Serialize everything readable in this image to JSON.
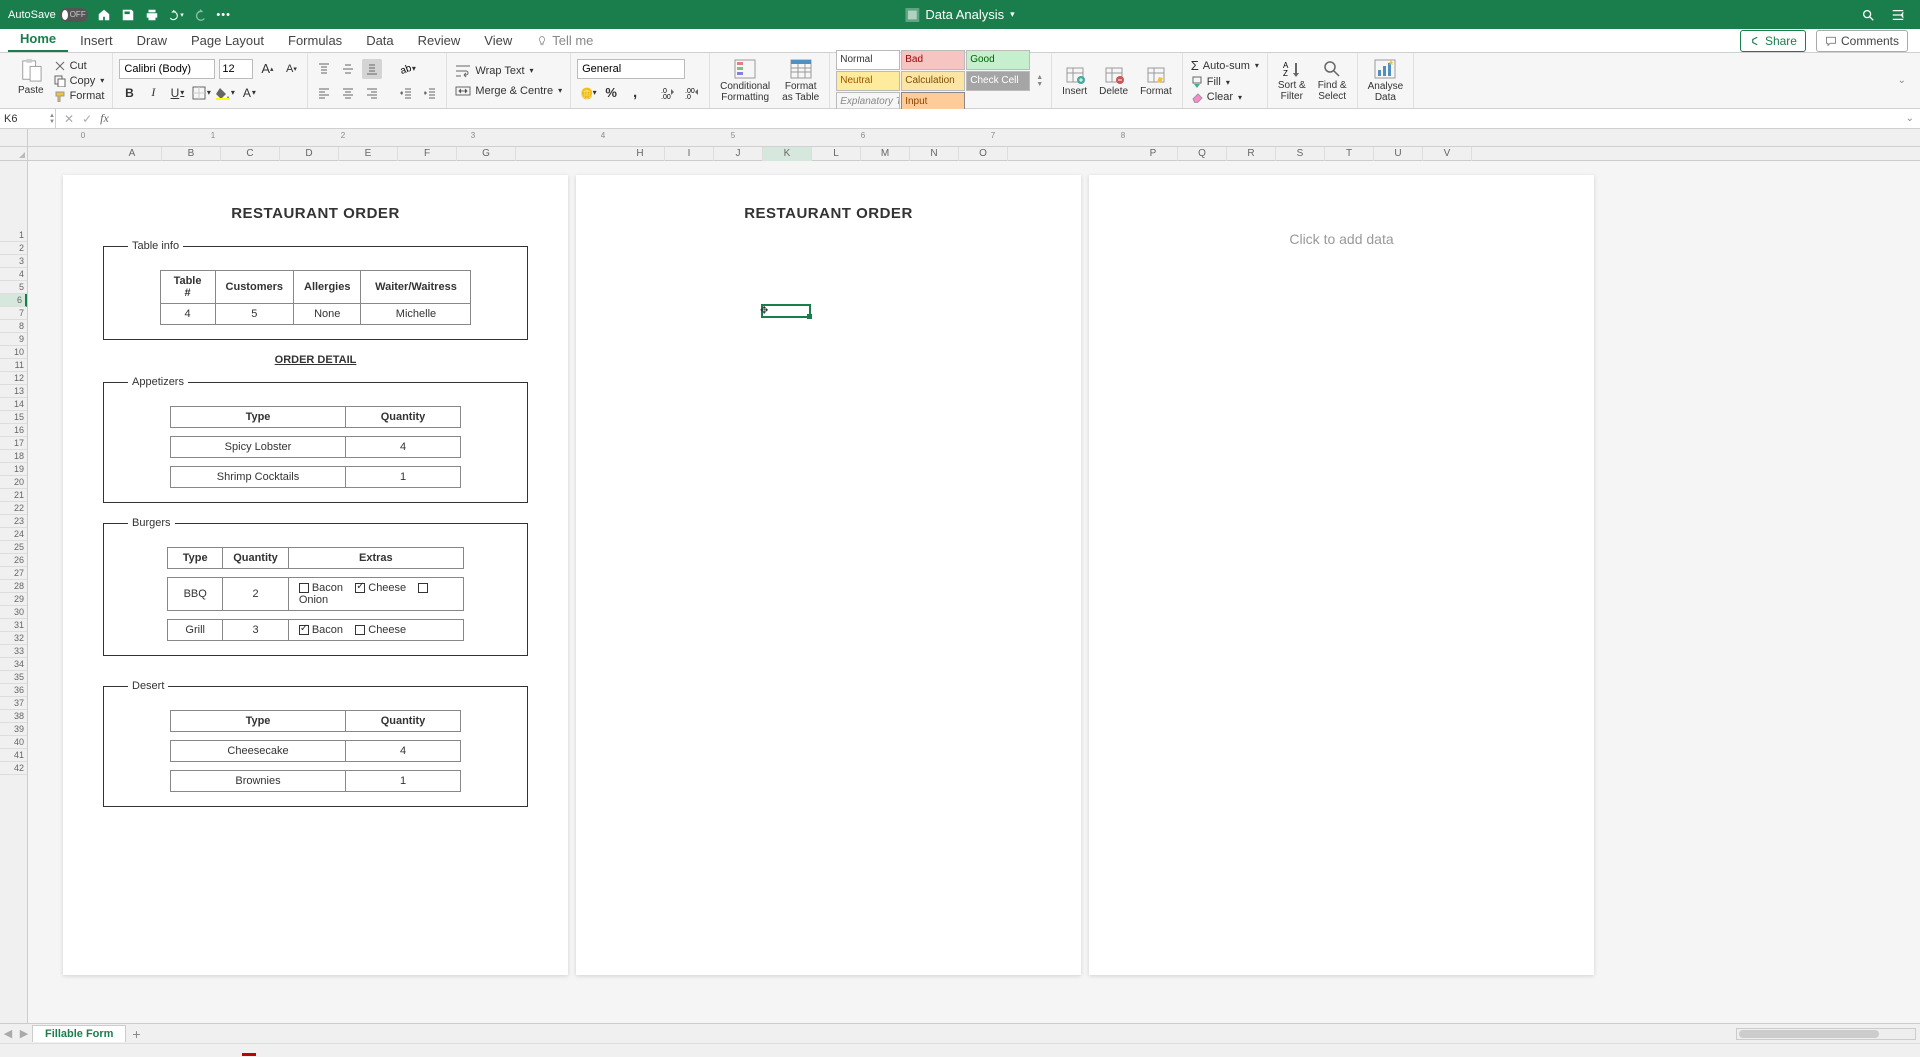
{
  "title_bar": {
    "autosave_label": "AutoSave",
    "autosave_state": "OFF",
    "doc_name": "Data Analysis"
  },
  "ribbon_tabs": [
    "Home",
    "Insert",
    "Draw",
    "Page Layout",
    "Formulas",
    "Data",
    "Review",
    "View"
  ],
  "tell_me": "Tell me",
  "share_label": "Share",
  "comments_label": "Comments",
  "clipboard": {
    "paste": "Paste",
    "cut": "Cut",
    "copy": "Copy",
    "format": "Format"
  },
  "font": {
    "name": "Calibri (Body)",
    "size": "12"
  },
  "alignment": {
    "wrap": "Wrap Text",
    "merge": "Merge & Centre"
  },
  "number_format": "General",
  "cond_fmt": "Conditional\nFormatting",
  "fmt_table": "Format\nas Table",
  "styles": {
    "normal": "Normal",
    "bad": "Bad",
    "good": "Good",
    "neutral": "Neutral",
    "calc": "Calculation",
    "check": "Check Cell",
    "expl": "Explanatory T…",
    "input": "Input"
  },
  "cells": {
    "insert": "Insert",
    "delete": "Delete",
    "format": "Format"
  },
  "editing": {
    "autosum": "Auto-sum",
    "fill": "Fill",
    "clear": "Clear",
    "sort": "Sort &\nFilter",
    "find": "Find &\nSelect"
  },
  "analyse": "Analyse\nData",
  "name_box": "K6",
  "columns": [
    "A",
    "B",
    "C",
    "D",
    "E",
    "F",
    "G",
    "H",
    "I",
    "J",
    "K",
    "L",
    "M",
    "N",
    "O",
    "P",
    "Q",
    "R",
    "S",
    "T",
    "U",
    "V"
  ],
  "col_active": "K",
  "row_active": 6,
  "doc": {
    "title": "RESTAURANT ORDER",
    "table_info": {
      "legend": "Table info",
      "headers": [
        "Table #",
        "Customers",
        "Allergies",
        "Waiter/Waitress"
      ],
      "row": [
        "4",
        "5",
        "None",
        "Michelle"
      ]
    },
    "order_detail": "ORDER DETAIL",
    "appetizers": {
      "legend": "Appetizers",
      "headers": [
        "Type",
        "Quantity"
      ],
      "rows": [
        [
          "Spicy Lobster",
          "4"
        ],
        [
          "Shrimp Cocktails",
          "1"
        ]
      ]
    },
    "burgers": {
      "legend": "Burgers",
      "headers": [
        "Type",
        "Quantity",
        "Extras"
      ],
      "rows": [
        {
          "type": "BBQ",
          "qty": "2",
          "extras": [
            {
              "label": "Bacon",
              "checked": false
            },
            {
              "label": "Cheese",
              "checked": true
            },
            {
              "label": "Onion",
              "checked": false
            }
          ]
        },
        {
          "type": "Grill",
          "qty": "3",
          "extras": [
            {
              "label": "Bacon",
              "checked": true
            },
            {
              "label": "Cheese",
              "checked": false
            }
          ]
        }
      ]
    },
    "desert": {
      "legend": "Desert",
      "headers": [
        "Type",
        "Quantity"
      ],
      "rows": [
        [
          "Cheesecake",
          "4"
        ],
        [
          "Brownies",
          "1"
        ]
      ]
    }
  },
  "page3_placeholder": "Click to add data",
  "sheet_tab": "Fillable Form"
}
